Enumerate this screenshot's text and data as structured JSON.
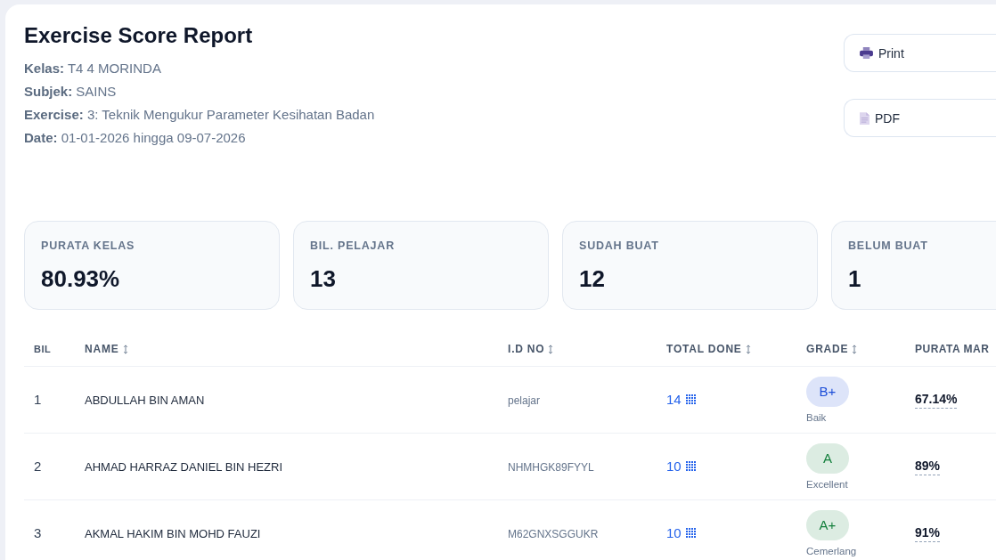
{
  "report": {
    "title": "Exercise Score Report",
    "meta": [
      "**Kelas:** T4 4 MORINDA",
      "**Subjek:** SAINS",
      "**Exercise:** 3: Teknik Mengukur Parameter Kesihatan Badan",
      "**Date:** 01-01-2026 hingga 09-07-2026"
    ]
  },
  "actions": [
    {
      "label": "Print",
      "kind": "print"
    },
    {
      "label": "PDF",
      "kind": "pdf"
    }
  ],
  "stats": [
    {
      "label": "PURATA KELAS",
      "value": "80.93%"
    },
    {
      "label": "BIL. PELAJAR",
      "value": "13"
    },
    {
      "label": "SUDAH BUAT",
      "value": "12"
    },
    {
      "label": "BELUM BUAT",
      "value": "1"
    }
  ],
  "table": {
    "columns": [
      {
        "label": "BIL",
        "sortable": false
      },
      {
        "label": "NAME",
        "sortable": true
      },
      {
        "label": "I.D NO",
        "sortable": true
      },
      {
        "label": "TOTAL DONE",
        "sortable": true
      },
      {
        "label": "GRADE",
        "sortable": true
      },
      {
        "label": "PURATA MAR",
        "sortable": false
      }
    ],
    "rows": [
      {
        "bil": "1",
        "name": "ABDULLAH BIN AMAN",
        "id_no": "pelajar",
        "total_done": "14",
        "grade": {
          "label": "B+",
          "description": "Baik",
          "color": "#1d4ed8"
        },
        "average_mark": "67.14%"
      },
      {
        "bil": "2",
        "name": "AHMAD HARRAZ DANIEL BIN HEZRI",
        "id_no": "NHMHGK89FYYL",
        "total_done": "10",
        "grade": {
          "label": "A",
          "description": "Excellent",
          "color": "#15803d"
        },
        "average_mark": "89%"
      },
      {
        "bil": "3",
        "name": "AKMAL HAKIM BIN MOHD FAUZI",
        "id_no": "M62GNXSGGUKR",
        "total_done": "10",
        "grade": {
          "label": "A+",
          "description": "Cemerlang",
          "color": "#15803d"
        },
        "average_mark": "91%"
      }
    ]
  }
}
